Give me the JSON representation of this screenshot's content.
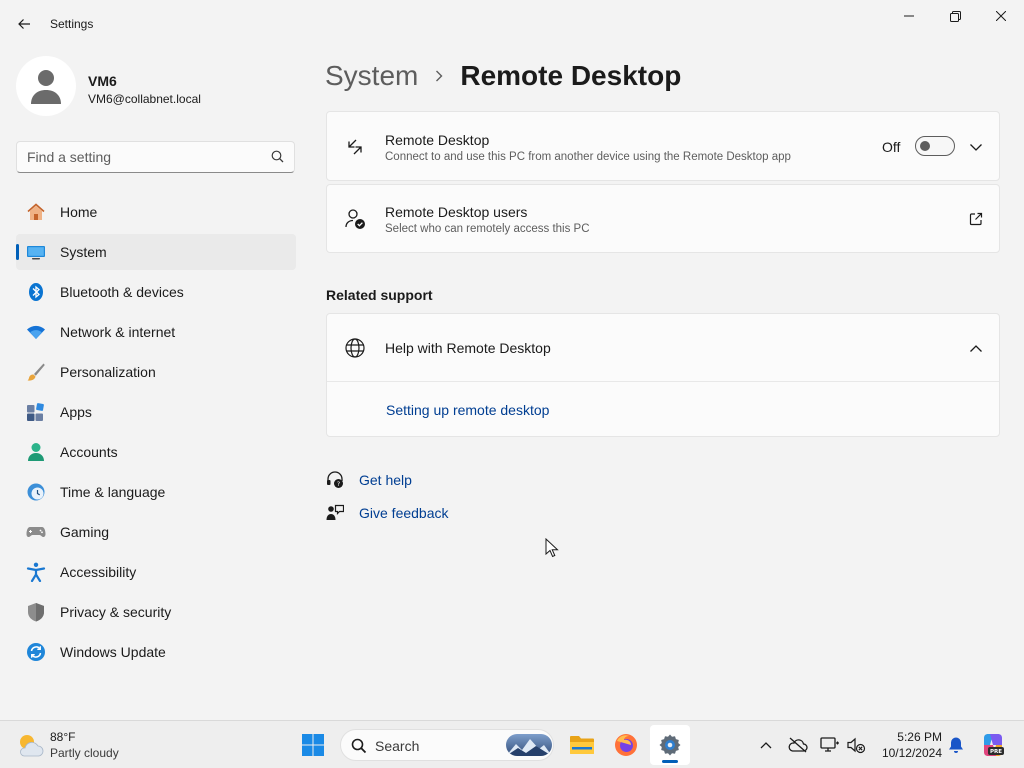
{
  "window": {
    "title": "Settings"
  },
  "profile": {
    "name": "VM6",
    "email": "VM6@collabnet.local"
  },
  "search": {
    "placeholder": "Find a setting"
  },
  "nav": {
    "items": [
      {
        "label": "Home",
        "icon": "home-icon"
      },
      {
        "label": "System",
        "icon": "system-icon",
        "active": true
      },
      {
        "label": "Bluetooth & devices",
        "icon": "bluetooth-icon"
      },
      {
        "label": "Network & internet",
        "icon": "wifi-icon"
      },
      {
        "label": "Personalization",
        "icon": "brush-icon"
      },
      {
        "label": "Apps",
        "icon": "apps-icon"
      },
      {
        "label": "Accounts",
        "icon": "accounts-icon"
      },
      {
        "label": "Time & language",
        "icon": "clock-globe-icon"
      },
      {
        "label": "Gaming",
        "icon": "gamepad-icon"
      },
      {
        "label": "Accessibility",
        "icon": "accessibility-icon"
      },
      {
        "label": "Privacy & security",
        "icon": "shield-icon"
      },
      {
        "label": "Windows Update",
        "icon": "update-icon"
      }
    ]
  },
  "breadcrumb": {
    "parent": "System",
    "current": "Remote Desktop"
  },
  "remote_desktop": {
    "title": "Remote Desktop",
    "description": "Connect to and use this PC from another device using the Remote Desktop app",
    "toggle_label": "Off",
    "enabled": false
  },
  "remote_users": {
    "title": "Remote Desktop users",
    "description": "Select who can remotely access this PC"
  },
  "related": {
    "heading": "Related support",
    "help_title": "Help with Remote Desktop",
    "help_link": "Setting up remote desktop"
  },
  "footer_links": {
    "get_help": "Get help",
    "give_feedback": "Give feedback"
  },
  "taskbar": {
    "weather_temp": "88°F",
    "weather_condition": "Partly cloudy",
    "search_label": "Search",
    "time": "5:26 PM",
    "date": "10/12/2024"
  },
  "colors": {
    "accent": "#005fb8",
    "link": "#003e92",
    "background": "#f3f3f3",
    "card": "#fbfbfb"
  }
}
